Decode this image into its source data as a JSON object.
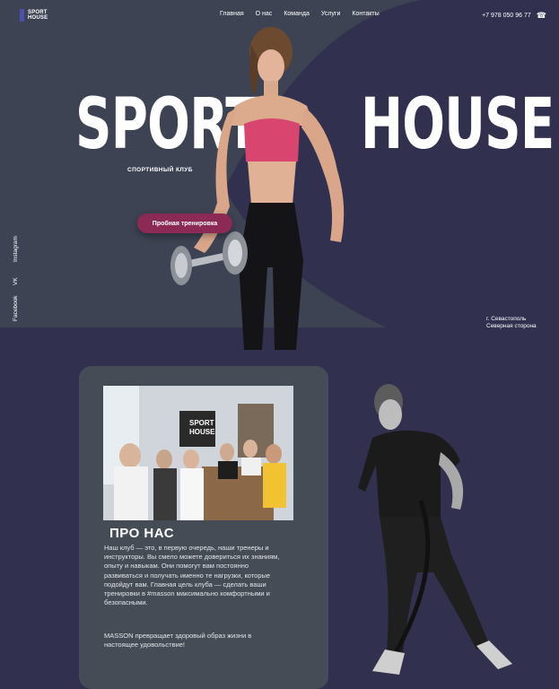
{
  "header": {
    "logo_line1": "SPORT",
    "logo_line2": "HOUSE",
    "nav": [
      "Главная",
      "О нас",
      "Команда",
      "Услуги",
      "Контакты"
    ],
    "phone": "+7 978 050 96 77",
    "phone_icon": "phone-icon"
  },
  "hero": {
    "word_left": "SPORT",
    "word_right": "HOUSE",
    "subtitle": "СПОРТИВНЫЙ КЛУБ",
    "cta_label": "Пробная тренировка",
    "location_line1": "г. Севастополь",
    "location_line2": "Северная сторона"
  },
  "social": [
    "Instagram",
    "VK",
    "Facebook"
  ],
  "about": {
    "title": "ПРО НАС",
    "paragraph1": "Наш клуб — это, в первую очередь, наши тренеры и инструкторы. Вы смело можете довериться их знаниям, опыту и навыкам. Они помогут вам постоянно развиваться и получать именно те нагрузки, которые подойдут вам. Главная цель клуба — сделать ваши тренировки в #masson максимально комфортными и безопасными.",
    "paragraph2": "MASSON превращает здоровый образ жизни в настоящее удовольствие!",
    "photo_sign_line1": "SPORT",
    "photo_sign_line2": "HOUSE"
  },
  "colors": {
    "background": "#31304f",
    "wave": "#3d4352",
    "card": "#454c56",
    "cta": "#8a2a55",
    "accent_pink": "#d8466f"
  }
}
